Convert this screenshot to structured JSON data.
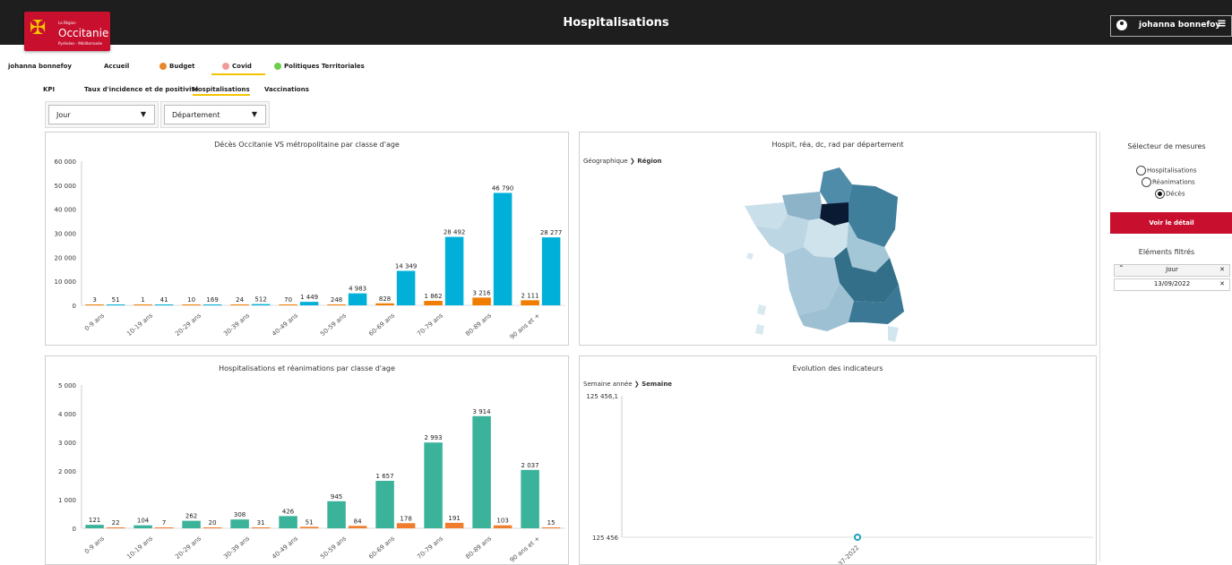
{
  "header": {
    "logo": {
      "small": "La Région",
      "big": "Occitanie",
      "sub": "Pyrénées - Méditerranée"
    },
    "title": "Hospitalisations",
    "user": "johanna bonnefoy",
    "menu_icon": "≡"
  },
  "nav": {
    "items": [
      {
        "label": "johanna bonnefoy"
      },
      {
        "label": "Accueil"
      },
      {
        "label": "Budget",
        "color": "#e8882e"
      },
      {
        "label": "Covid",
        "color": "#f29b9b"
      },
      {
        "label": "Politiques Territoriales",
        "color": "#6ccf4a"
      }
    ],
    "subtabs": [
      {
        "label": "KPI"
      },
      {
        "label": "Taux d'incidence et de positivité"
      },
      {
        "label": "Hospitalisations"
      },
      {
        "label": "Vaccinations"
      }
    ]
  },
  "filters": {
    "period": "Jour",
    "geo": "Département"
  },
  "chart_data": [
    {
      "type": "bar",
      "title": "Décès Occitanie VS métropolitaine par classe d'age",
      "categories": [
        "0-9 ans",
        "10-19 ans",
        "20-29 ans",
        "30-39 ans",
        "40-49 ans",
        "50-59 ans",
        "60-69 ans",
        "70-79 ans",
        "80-89 ans",
        "90 ans et +"
      ],
      "series": [
        {
          "values": [
            3,
            1,
            10,
            24,
            70,
            248,
            828,
            1862,
            3216,
            2111
          ],
          "color": "#f07d00"
        },
        {
          "values": [
            51,
            41,
            169,
            512,
            1449,
            4983,
            14349,
            28492,
            46790,
            28277
          ],
          "color": "#00b0d8"
        }
      ],
      "value_labels": [
        [
          "3",
          "1",
          "10",
          "24",
          "70",
          "248",
          "828",
          "1 862",
          "3 216",
          "2 111"
        ],
        [
          "51",
          "41",
          "169",
          "512",
          "1 449",
          "4 983",
          "14 349",
          "28 492",
          "46 790",
          "28 277"
        ]
      ],
      "yticks": [
        "0",
        "10 000",
        "20 000",
        "30 000",
        "40 000",
        "50 000",
        "60 000"
      ],
      "ylim": [
        0,
        60000
      ]
    },
    {
      "type": "bar",
      "title": "Hospitalisations et réanimations par classe d'age",
      "categories": [
        "0-9 ans",
        "10-19 ans",
        "20-29 ans",
        "30-39 ans",
        "40-49 ans",
        "50-59 ans",
        "60-69 ans",
        "70-79 ans",
        "80-89 ans",
        "90 ans et +"
      ],
      "series": [
        {
          "values": [
            121,
            104,
            262,
            308,
            426,
            945,
            1657,
            2993,
            3914,
            2037
          ],
          "color": "#3bb39a"
        },
        {
          "values": [
            22,
            7,
            20,
            31,
            51,
            84,
            178,
            191,
            103,
            15
          ],
          "color": "#f07d2e"
        }
      ],
      "value_labels": [
        [
          "121",
          "104",
          "262",
          "308",
          "426",
          "945",
          "1 657",
          "2 993",
          "3 914",
          "2 037"
        ],
        [
          "22",
          "7",
          "20",
          "31",
          "51",
          "84",
          "178",
          "191",
          "103",
          "15"
        ]
      ],
      "yticks": [
        "0",
        "1 000",
        "2 000",
        "3 000",
        "4 000",
        "5 000"
      ],
      "ylim": [
        0,
        5000
      ]
    },
    {
      "type": "line",
      "title": "Evolution des indicateurs",
      "x": [
        "37-2022"
      ],
      "series": [
        {
          "values": [
            125456
          ]
        }
      ],
      "yticks": [
        "125 456",
        "125 456,1"
      ]
    }
  ],
  "map_panel": {
    "title": "Hospit, réa, dc, rad par département",
    "crumb_parent": "Géographique",
    "crumb_current": "Région"
  },
  "evo_panel": {
    "crumb_parent": "Semaine année",
    "crumb_current": "Semaine"
  },
  "measures": {
    "title": "Sélecteur de mesures",
    "options": [
      "Hospitalisations",
      "Réanimations",
      "Décès"
    ],
    "selected": "Décès",
    "detail_button": "Voir le détail",
    "filtered_title": "Eléments filtrés",
    "filter_field": "Jour",
    "filter_value": "13/09/2022"
  }
}
